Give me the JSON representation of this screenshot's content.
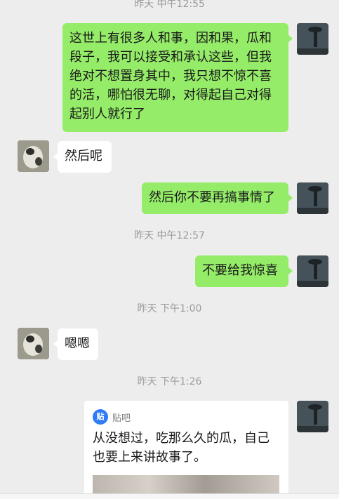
{
  "timestamps": [
    "昨天 中午12:55",
    "昨天 中午12:57",
    "昨天 下午1:00",
    "昨天 下午1:26"
  ],
  "messages": [
    {
      "from": "self",
      "text": "这世上有很多人和事，因和果，瓜和段子，我可以接受和承认这些，但我绝对不想置身其中，我只想不惊不喜的活，哪怕很无聊，对得起自己对得起别人就行了"
    },
    {
      "from": "other",
      "text": "然后呢"
    },
    {
      "from": "self",
      "text": "然后你不要再搞事情了"
    },
    {
      "from": "self",
      "text": "不要给我惊喜"
    },
    {
      "from": "other",
      "text": "嗯嗯"
    }
  ],
  "share_card": {
    "source_icon_text": "贴",
    "source_name": "贴吧",
    "title": "从没想过，吃那么久的瓜，自己也要上来讲故事了。"
  },
  "colors": {
    "self_bubble": "#95ec69",
    "other_bubble": "#ffffff",
    "background": "#ededed",
    "tieba_blue": "#2f7df6"
  }
}
